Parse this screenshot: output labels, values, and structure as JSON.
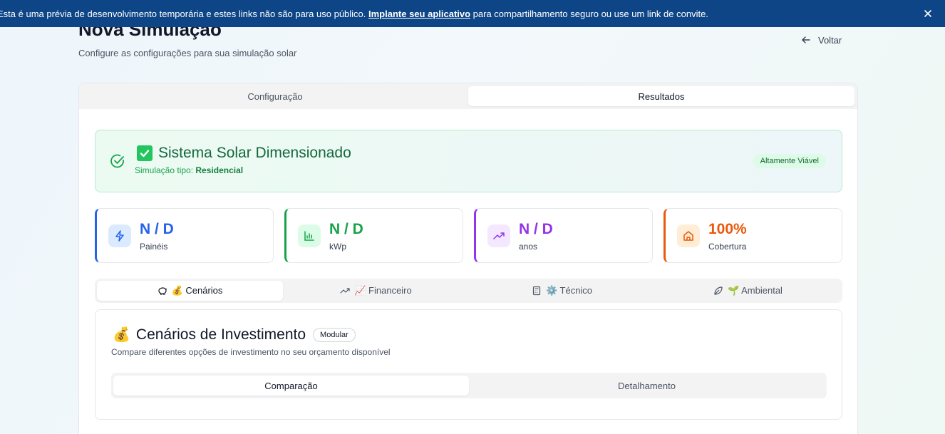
{
  "banner": {
    "text_before": "Esta é uma prévia de desenvolvimento temporária e estes links não são para uso público. ",
    "link": "Implante seu aplicativo",
    "text_after": " para compartilhamento seguro ou use um link de convite."
  },
  "header": {
    "title": "Nova Simulação",
    "subtitle": "Configure as configurações para sua simulação solar",
    "back_label": "Voltar"
  },
  "main_tabs": [
    {
      "label": "Configuração",
      "active": false
    },
    {
      "label": "Resultados",
      "active": true
    }
  ],
  "success": {
    "title": "Sistema Solar Dimensionado",
    "type_prefix": "Simulação tipo: ",
    "type_value": "Residencial",
    "badge": "Altamente Viável"
  },
  "stats": [
    {
      "value": "N / D",
      "label": "Painéis",
      "icon": "zap-icon",
      "color": "#2563eb"
    },
    {
      "value": "N / D",
      "label": "kWp",
      "icon": "bar-chart-icon",
      "color": "#16a34a"
    },
    {
      "value": "N / D",
      "label": "anos",
      "icon": "trending-up-icon",
      "color": "#9333ea"
    },
    {
      "value": "100%",
      "label": "Cobertura",
      "icon": "home-icon",
      "color": "#ea580c"
    }
  ],
  "sub_tabs": [
    {
      "label": "💰 Cenários",
      "icon": "piggy-bank-icon",
      "active": true
    },
    {
      "label": "📈 Financeiro",
      "icon": "trending-up-icon",
      "active": false
    },
    {
      "label": "⚙️ Técnico",
      "icon": "calculator-icon",
      "active": false
    },
    {
      "label": "🌱 Ambiental",
      "icon": "leaf-icon",
      "active": false
    }
  ],
  "investment": {
    "emoji": "💰",
    "title": "Cenários de Investimento",
    "badge": "Modular",
    "subtitle": "Compare diferentes opções de investimento no seu orçamento disponível",
    "tabs": [
      {
        "label": "Comparação",
        "active": true
      },
      {
        "label": "Detalhamento",
        "active": false
      }
    ]
  }
}
